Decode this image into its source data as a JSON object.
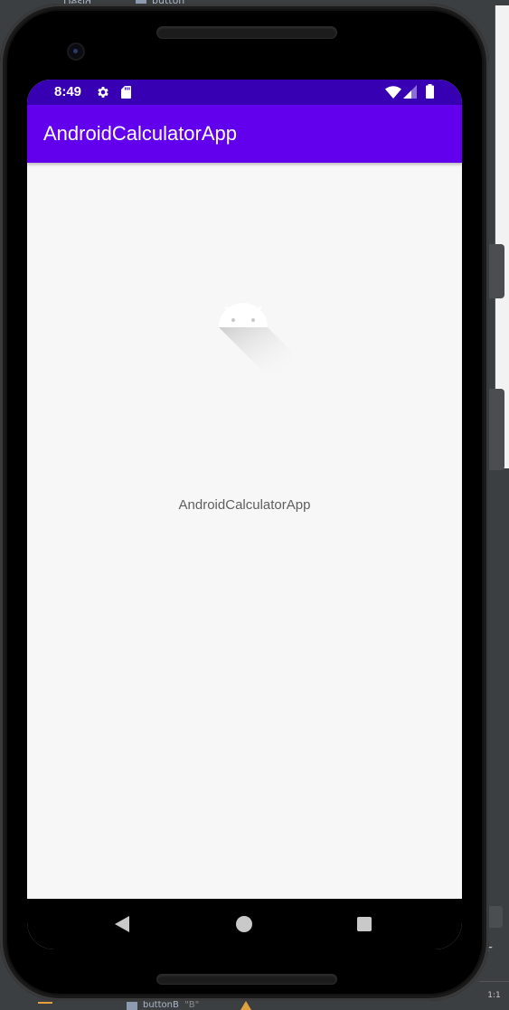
{
  "ide": {
    "top_text": "Desig",
    "top_component": "button",
    "bottom_component": "buttonB",
    "bottom_value": "\"B\"",
    "zoom_label": "1:1",
    "plus_label": "+"
  },
  "status_bar": {
    "time": "8:49",
    "icons": [
      "gear-icon",
      "sd-card-icon",
      "wifi-icon",
      "signal-icon",
      "battery-icon"
    ]
  },
  "app_bar": {
    "title": "AndroidCalculatorApp"
  },
  "splash": {
    "label": "AndroidCalculatorApp",
    "icon": "android-icon"
  },
  "nav_bar": {
    "buttons": [
      "back-icon",
      "home-icon",
      "recents-icon"
    ]
  },
  "colors": {
    "status_bar": "#3700b3",
    "app_bar": "#6200ee",
    "screen_bg": "#f7f7f8"
  }
}
